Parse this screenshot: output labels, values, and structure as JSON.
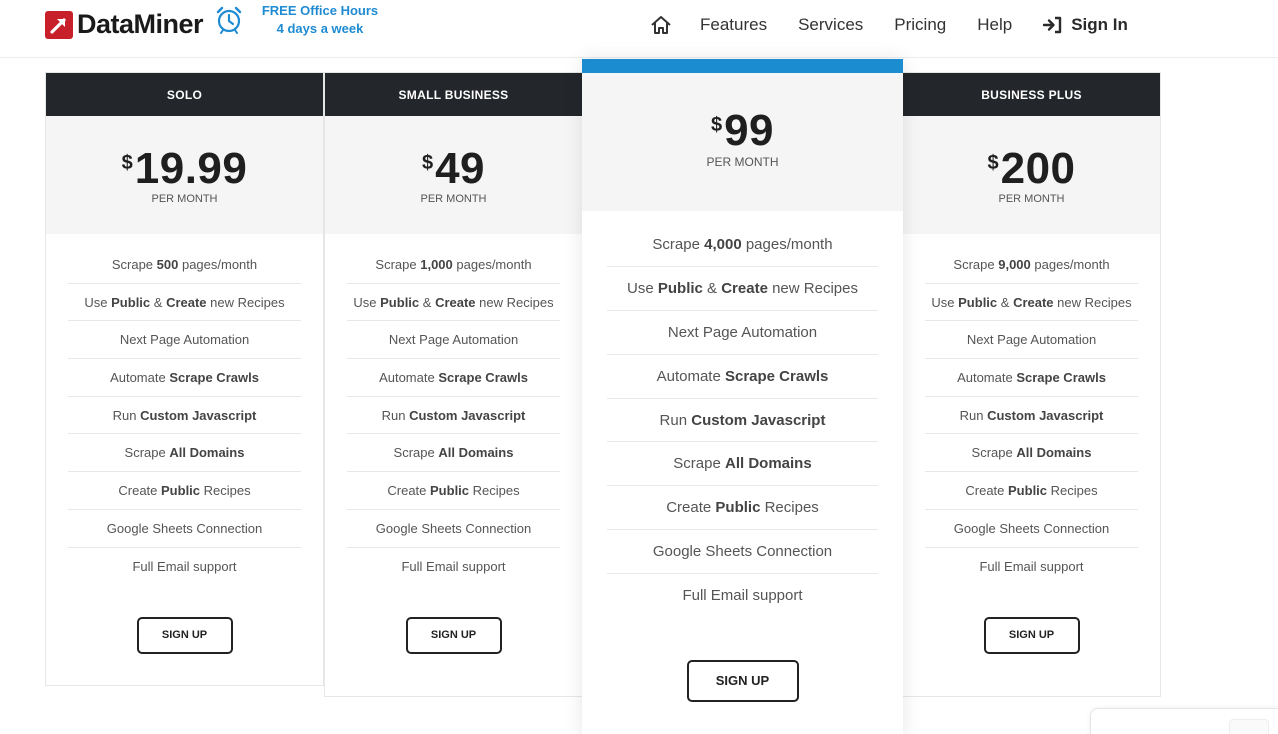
{
  "header": {
    "logo_text": "DataMiner",
    "office_line1": "FREE Office Hours",
    "office_line2": "4 days a week",
    "nav": {
      "features": "Features",
      "services": "Services",
      "pricing": "Pricing",
      "help": "Help",
      "sign_in": "Sign In"
    },
    "icons": [
      "logo-arrow-icon",
      "alarm-clock-icon",
      "home-icon",
      "sign-in-icon"
    ]
  },
  "colors": {
    "brand_red": "#c8202a",
    "accent_blue": "#1f8bd2",
    "featured_bar": "#1a8ccf",
    "card_header": "#23262b"
  },
  "plans": {
    "solo": {
      "name": "SOLO",
      "currency": "$",
      "price": "19.99",
      "period": "PER MONTH",
      "features": [
        {
          "pre": "Scrape ",
          "b": "500",
          "post": " pages/month"
        },
        {
          "pre": "Use ",
          "b": "Public",
          "mid": " & ",
          "b2": "Create",
          "post": " new Recipes"
        },
        {
          "pre": "Next Page Automation",
          "b": "",
          "post": ""
        },
        {
          "pre": "Automate ",
          "b": "Scrape Crawls",
          "post": ""
        },
        {
          "pre": "Run ",
          "b": "Custom Javascript",
          "post": ""
        },
        {
          "pre": "Scrape ",
          "b": "All Domains",
          "post": ""
        },
        {
          "pre": "Create ",
          "b": "Public",
          "post": " Recipes"
        },
        {
          "pre": "Google Sheets Connection",
          "b": "",
          "post": ""
        },
        {
          "pre": "Full Email support",
          "b": "",
          "post": ""
        }
      ],
      "button": "SIGN UP"
    },
    "small_business": {
      "name": "SMALL BUSINESS",
      "currency": "$",
      "price": "49",
      "period": "PER MONTH",
      "features": [
        {
          "pre": "Scrape ",
          "b": "1,000",
          "post": " pages/month"
        },
        {
          "pre": "Use ",
          "b": "Public",
          "mid": " & ",
          "b2": "Create",
          "post": " new Recipes"
        },
        {
          "pre": "Next Page Automation",
          "b": "",
          "post": ""
        },
        {
          "pre": "Automate ",
          "b": "Scrape Crawls",
          "post": ""
        },
        {
          "pre": "Run ",
          "b": "Custom Javascript",
          "post": ""
        },
        {
          "pre": "Scrape ",
          "b": "All Domains",
          "post": ""
        },
        {
          "pre": "Create ",
          "b": "Public",
          "post": " Recipes"
        },
        {
          "pre": "Google Sheets Connection",
          "b": "",
          "post": ""
        },
        {
          "pre": "Full Email support",
          "b": "",
          "post": ""
        }
      ],
      "button": "SIGN UP"
    },
    "featured": {
      "currency": "$",
      "price": "99",
      "period": "PER MONTH",
      "features": [
        {
          "pre": "Scrape ",
          "b": "4,000",
          "post": " pages/month"
        },
        {
          "pre": "Use ",
          "b": "Public",
          "mid": " & ",
          "b2": "Create",
          "post": " new Recipes"
        },
        {
          "pre": "Next Page Automation",
          "b": "",
          "post": ""
        },
        {
          "pre": "Automate ",
          "b": "Scrape Crawls",
          "post": ""
        },
        {
          "pre": "Run ",
          "b": "Custom Javascript",
          "post": ""
        },
        {
          "pre": "Scrape ",
          "b": "All Domains",
          "post": ""
        },
        {
          "pre": "Create ",
          "b": "Public",
          "post": " Recipes"
        },
        {
          "pre": "Google Sheets Connection",
          "b": "",
          "post": ""
        },
        {
          "pre": "Full Email support",
          "b": "",
          "post": ""
        }
      ],
      "button": "SIGN UP"
    },
    "business_plus": {
      "name": "BUSINESS PLUS",
      "currency": "$",
      "price": "200",
      "period": "PER MONTH",
      "features": [
        {
          "pre": "Scrape ",
          "b": "9,000",
          "post": " pages/month"
        },
        {
          "pre": "Use ",
          "b": "Public",
          "mid": " & ",
          "b2": "Create",
          "post": " new Recipes"
        },
        {
          "pre": "Next Page Automation",
          "b": "",
          "post": ""
        },
        {
          "pre": "Automate ",
          "b": "Scrape Crawls",
          "post": ""
        },
        {
          "pre": "Run ",
          "b": "Custom Javascript",
          "post": ""
        },
        {
          "pre": "Scrape ",
          "b": "All Domains",
          "post": ""
        },
        {
          "pre": "Create ",
          "b": "Public",
          "post": " Recipes"
        },
        {
          "pre": "Google Sheets Connection",
          "b": "",
          "post": ""
        },
        {
          "pre": "Full Email support",
          "b": "",
          "post": ""
        }
      ],
      "button": "SIGN UP"
    }
  }
}
